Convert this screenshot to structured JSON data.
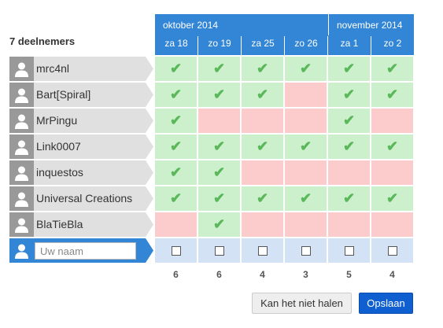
{
  "poll": {
    "participant_count_label": "7 deelnemers",
    "months": [
      {
        "label": "oktober 2014"
      },
      {
        "label": "november 2014"
      }
    ],
    "dates": [
      {
        "label": "za 18",
        "total": "6"
      },
      {
        "label": "zo 19",
        "total": "6"
      },
      {
        "label": "za 25",
        "total": "4"
      },
      {
        "label": "zo 26",
        "total": "3"
      },
      {
        "label": "za 1",
        "total": "5"
      },
      {
        "label": "zo 2",
        "total": "4"
      }
    ],
    "participants": [
      {
        "name": "mrc4nl",
        "votes": [
          true,
          true,
          true,
          true,
          true,
          true
        ]
      },
      {
        "name": "Bart[Spiral]",
        "votes": [
          true,
          true,
          true,
          false,
          true,
          true
        ]
      },
      {
        "name": "MrPingu",
        "votes": [
          true,
          false,
          false,
          false,
          true,
          false
        ]
      },
      {
        "name": "Link0007",
        "votes": [
          true,
          true,
          true,
          true,
          true,
          true
        ]
      },
      {
        "name": "inquestos",
        "votes": [
          true,
          true,
          false,
          false,
          false,
          false
        ]
      },
      {
        "name": "Universal Creations",
        "votes": [
          true,
          true,
          true,
          true,
          true,
          true
        ]
      },
      {
        "name": "BlaTieBla",
        "votes": [
          false,
          true,
          false,
          false,
          false,
          false
        ]
      }
    ],
    "new_entry": {
      "placeholder": "Uw naam"
    },
    "colors": {
      "header_blue": "#3385d6",
      "yes_green": "#ccf0cc",
      "no_red": "#fccccc",
      "checkmark_green": "#5ab85a",
      "checkbox_row_blue": "#d3e3f5",
      "save_button_blue": "#0f5fd0"
    }
  },
  "actions": {
    "cannot_attend_label": "Kan het niet halen",
    "save_label": "Opslaan"
  }
}
